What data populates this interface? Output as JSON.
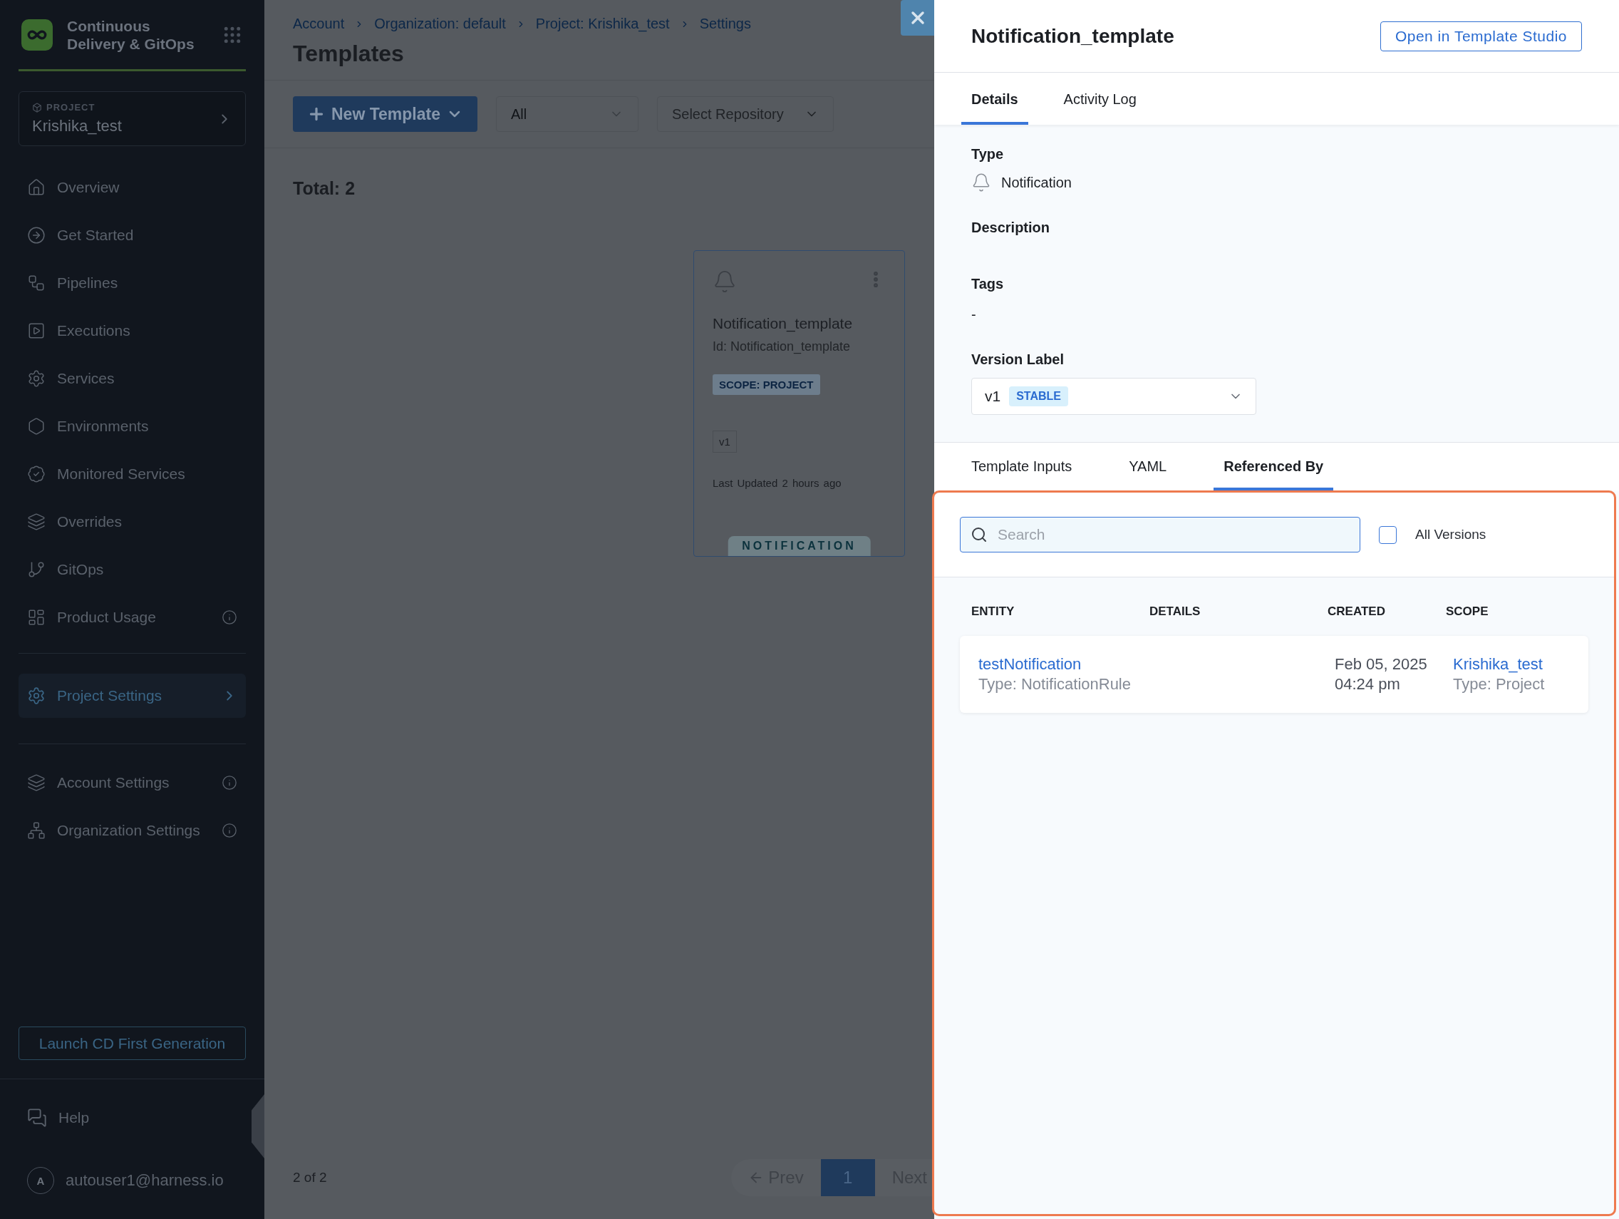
{
  "app": {
    "title": "Continuous Delivery & GitOps"
  },
  "project": {
    "label": "PROJECT",
    "name": "Krishika_test"
  },
  "nav": [
    {
      "label": "Overview",
      "selected": false,
      "info": false
    },
    {
      "label": "Get Started",
      "selected": false,
      "info": false
    },
    {
      "label": "Pipelines",
      "selected": false,
      "info": false
    },
    {
      "label": "Executions",
      "selected": false,
      "info": false
    },
    {
      "label": "Services",
      "selected": false,
      "info": false
    },
    {
      "label": "Environments",
      "selected": false,
      "info": false
    },
    {
      "label": "Monitored Services",
      "selected": false,
      "info": false
    },
    {
      "label": "Overrides",
      "selected": false,
      "info": false
    },
    {
      "label": "GitOps",
      "selected": false,
      "info": false
    },
    {
      "label": "Product Usage",
      "selected": false,
      "info": true
    }
  ],
  "settings_nav": {
    "label": "Project Settings",
    "selected": true
  },
  "other_nav": [
    {
      "label": "Account Settings",
      "info": true
    },
    {
      "label": "Organization Settings",
      "info": true
    }
  ],
  "launch_button": "Launch CD First Generation",
  "help": "Help",
  "user": {
    "initial": "A",
    "email": "autouser1@harness.io"
  },
  "breadcrumbs": [
    "Account",
    "Organization: default",
    "Project: Krishika_test",
    "Settings"
  ],
  "page_title": "Templates",
  "toolbar": {
    "new_button": "New Template",
    "type_filter": "All",
    "repo_placeholder": "Select Repository"
  },
  "total": "Total: 2",
  "card": {
    "name": "Notification_template",
    "id": "Id: Notification_template",
    "scope": "SCOPE: PROJECT",
    "version": "v1",
    "updated_label": "Last Updated",
    "updated": "2 hours ago",
    "type_tab": "NOTIFICATION"
  },
  "footer": {
    "count": "2 of 2",
    "prev": "Prev",
    "pages": [
      {
        "label": "1",
        "selected": true
      }
    ],
    "next": "Next"
  },
  "drawer": {
    "title": "Notification_template",
    "open_button": "Open in Template Studio",
    "tabs": [
      {
        "label": "Details",
        "selected": true
      },
      {
        "label": "Activity Log",
        "selected": false
      }
    ],
    "type_label": "Type",
    "type_value": "Notification",
    "description_label": "Description",
    "tags_label": "Tags",
    "tags_value": "-",
    "version_label": "Version Label",
    "version": {
      "value": "v1",
      "badge": "STABLE"
    },
    "sub_tabs": [
      {
        "label": "Template Inputs",
        "selected": false
      },
      {
        "label": "YAML",
        "selected": false
      },
      {
        "label": "Referenced By",
        "selected": true
      }
    ],
    "search": {
      "placeholder": "Search"
    },
    "all_versions": {
      "label": "All Versions",
      "checked": false
    },
    "table": {
      "columns": [
        "ENTITY",
        "DETAILS",
        "CREATED",
        "SCOPE"
      ],
      "rows": [
        {
          "entity": "testNotification",
          "entity_type": "Type: NotificationRule",
          "created_date": "Feb 05, 2025",
          "created_time": "04:24 pm",
          "scope": "Krishika_test",
          "scope_type": "Type: Project"
        }
      ]
    }
  }
}
